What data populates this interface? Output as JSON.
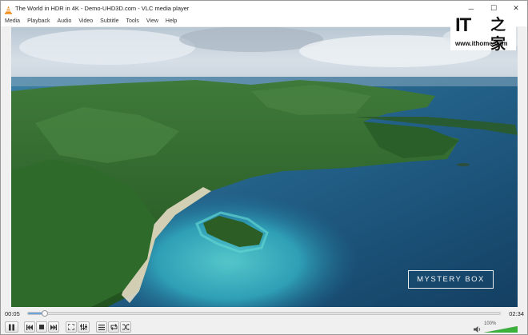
{
  "window": {
    "title": "The World in HDR in 4K - Demo-UHD3D.com - VLC media player"
  },
  "window_buttons": {
    "minimize": "─",
    "maximize": "☐",
    "close": "✕"
  },
  "menu": [
    "Media",
    "Playback",
    "Audio",
    "Video",
    "Subtitle",
    "Tools",
    "View",
    "Help"
  ],
  "watermark": {
    "logo_text": "IT",
    "logo_cn": "之家",
    "url": "www.ithome.com"
  },
  "video": {
    "overlay_text": "MYSTERY BOX"
  },
  "playback": {
    "current_time": "00:05",
    "total_time": "02:34",
    "progress": 0.035
  },
  "volume": {
    "percent_label": "100%",
    "level": 1.0
  },
  "colors": {
    "accent": "#6ea5d8",
    "volume_green": "#3bb03b",
    "ocean": "#1d4f72",
    "turquoise": "#3fb3c2",
    "forest": "#2f6a2c"
  },
  "icons": [
    "vlc-cone-icon",
    "pause-icon",
    "previous-icon",
    "stop-icon",
    "next-icon",
    "fullscreen-icon",
    "extended-settings-icon",
    "playlist-icon",
    "loop-icon",
    "shuffle-icon",
    "speaker-icon"
  ]
}
